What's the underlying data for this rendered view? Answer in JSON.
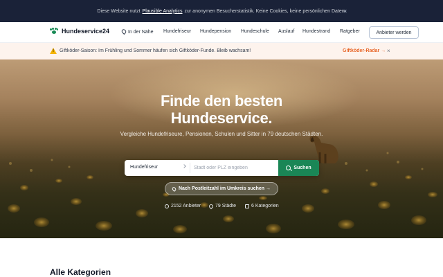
{
  "cookie_bar": {
    "text_before": "Diese Website nutzt",
    "link": "Plausible Analytics",
    "text_after": "zur anonymen Besucherstatistik. Keine Cookies, keine persönlichen Daten.",
    "close": "×"
  },
  "header": {
    "brand": "Hundeservice24",
    "nav": [
      "In der Nähe",
      "Hundefriseur",
      "Hundepension",
      "Hundeschule",
      "Auslauf",
      "Hundestrand",
      "Ratgeber"
    ],
    "cta": "Anbieter werden"
  },
  "alert": {
    "icon": "warning-icon",
    "message": "Giftköder-Saison: Im Frühling und Sommer häufen sich Giftköder-Funde. Bleib wachsam!",
    "link": "Giftköder-Radar →",
    "close": "×",
    "accent": "#e8672a"
  },
  "hero": {
    "title_line1": "Finde den besten",
    "title_line2": "Hundeservice.",
    "subtitle": "Vergleiche Hundefriseure, Pensionen, Schulen und Sitter in 79 deutschen Städten.",
    "search": {
      "category": "Hundefriseur",
      "placeholder": "Stadt oder PLZ eingeben",
      "button": "Suchen"
    },
    "plz_button": "Nach Postleitzahl im Umkreis suchen →",
    "stats": [
      "2152 Anbieter",
      "79 Städte",
      "6 Kategorien"
    ]
  },
  "section": {
    "title": "Alle Kategorien"
  },
  "colors": {
    "primary": "#1a8656",
    "cookie_bg": "#1a2238",
    "alert_bg": "#fdf3ed"
  }
}
